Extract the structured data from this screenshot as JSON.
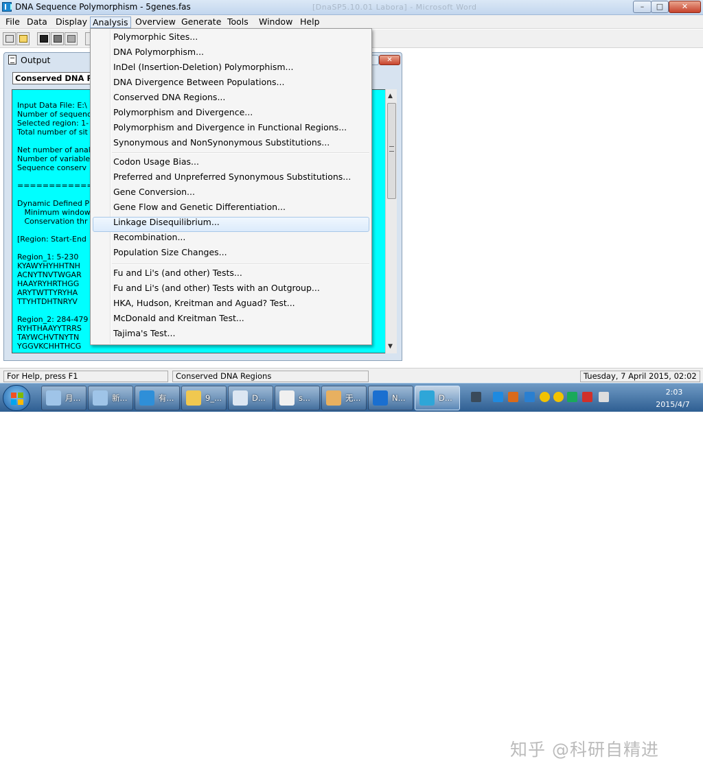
{
  "window": {
    "title": "DNA Sequence Polymorphism - 5genes.fas",
    "ghost_title": "[DnaSP5.10.01 Labora] - Microsoft Word"
  },
  "menubar": [
    "File",
    "Data",
    "Display",
    "Analysis",
    "Overview",
    "Generate",
    "Tools",
    "Window",
    "Help"
  ],
  "toolbar": {
    "icons": [
      "open-folder-icon",
      "folder-icon",
      "save-icon",
      "print-icon",
      "preview-icon",
      "extra-icon"
    ]
  },
  "output": {
    "title": "Output",
    "header": "Conserved DNA Regions",
    "lines": [
      "Input Data File: E:\\",
      "Number of sequence",
      "Selected region: 1-",
      "Total number of sit",
      "",
      "Net number of anal",
      "Number of variable",
      "Sequence conserv",
      "",
      "====================",
      "",
      "Dynamic Defined P",
      "   Minimum window",
      "   Conservation thr",
      "",
      "[Region: Start-End",
      "",
      "Region_1: 5-230",
      "KYAWYHYHHTNH",
      "ACNYTNVTWGAR",
      "HAAYRYHRTHGG",
      "ARYTWTTYRYHA",
      "TTYHTDHTNRYV",
      "",
      "Region_2: 284-479",
      "RYHTHAAYYTRRS",
      "TAYWCHVTNYTN",
      "YGGVKCHHTHCG"
    ]
  },
  "analysis_menu": {
    "groups": [
      [
        "Polymorphic Sites...",
        "DNA Polymorphism...",
        "InDel (Insertion-Deletion) Polymorphism...",
        "DNA Divergence Between Populations...",
        "Conserved DNA Regions...",
        "Polymorphism and Divergence...",
        "Polymorphism and Divergence in Functional Regions...",
        "Synonymous and NonSynonymous Substitutions..."
      ],
      [
        "Codon Usage Bias...",
        "Preferred and Unpreferred Synonymous Substitutions...",
        "Gene Conversion...",
        "Gene Flow and Genetic Differentiation...",
        "Linkage Disequilibrium...",
        "Recombination...",
        "Population Size Changes..."
      ],
      [
        "Fu and Li's (and other) Tests...",
        "Fu and Li's (and other) Tests with an Outgroup...",
        "HKA, Hudson, Kreitman and Aguad? Test...",
        "McDonald and Kreitman Test...",
        "Tajima's Test..."
      ]
    ],
    "highlighted": "Linkage Disequilibrium..."
  },
  "status": {
    "help": "For Help, press F1",
    "current": "Conserved DNA Regions",
    "datetime": "Tuesday, 7 April 2015, 02:02"
  },
  "watermark": "知乎 @科研自精进",
  "taskbar": {
    "tasks": [
      {
        "label": "月...",
        "icon": "notepad-icon"
      },
      {
        "label": "新...",
        "icon": "notepad-icon"
      },
      {
        "label": "有...",
        "icon": "youdao-icon"
      },
      {
        "label": "9_...",
        "icon": "folder-icon"
      },
      {
        "label": "D...",
        "icon": "word-icon"
      },
      {
        "label": "s...",
        "icon": "face-icon"
      },
      {
        "label": "无...",
        "icon": "paint-icon"
      },
      {
        "label": "N...",
        "icon": "sogou-icon"
      },
      {
        "label": "D...",
        "icon": "dnasp-icon"
      }
    ],
    "clock_time": "2:03",
    "clock_date": "2015/4/7"
  }
}
